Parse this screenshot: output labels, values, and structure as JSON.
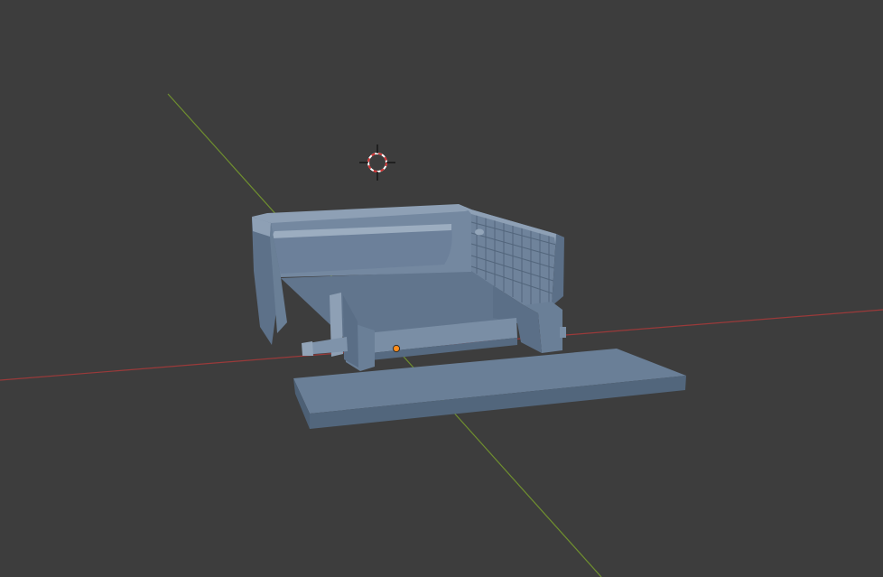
{
  "viewport": {
    "background_color": "#3d3d3d",
    "x_axis_color": "#9a3a3a",
    "y_axis_color": "#6f8f2f",
    "model_base_color": "#6a7f97",
    "model_shadow_color": "#52667c",
    "model_highlight_color": "#8ea0b5",
    "cursor_icon": "3d-cursor-icon",
    "origin_icon": "object-origin-dot-icon",
    "origin_color": "#ff8c1a"
  }
}
